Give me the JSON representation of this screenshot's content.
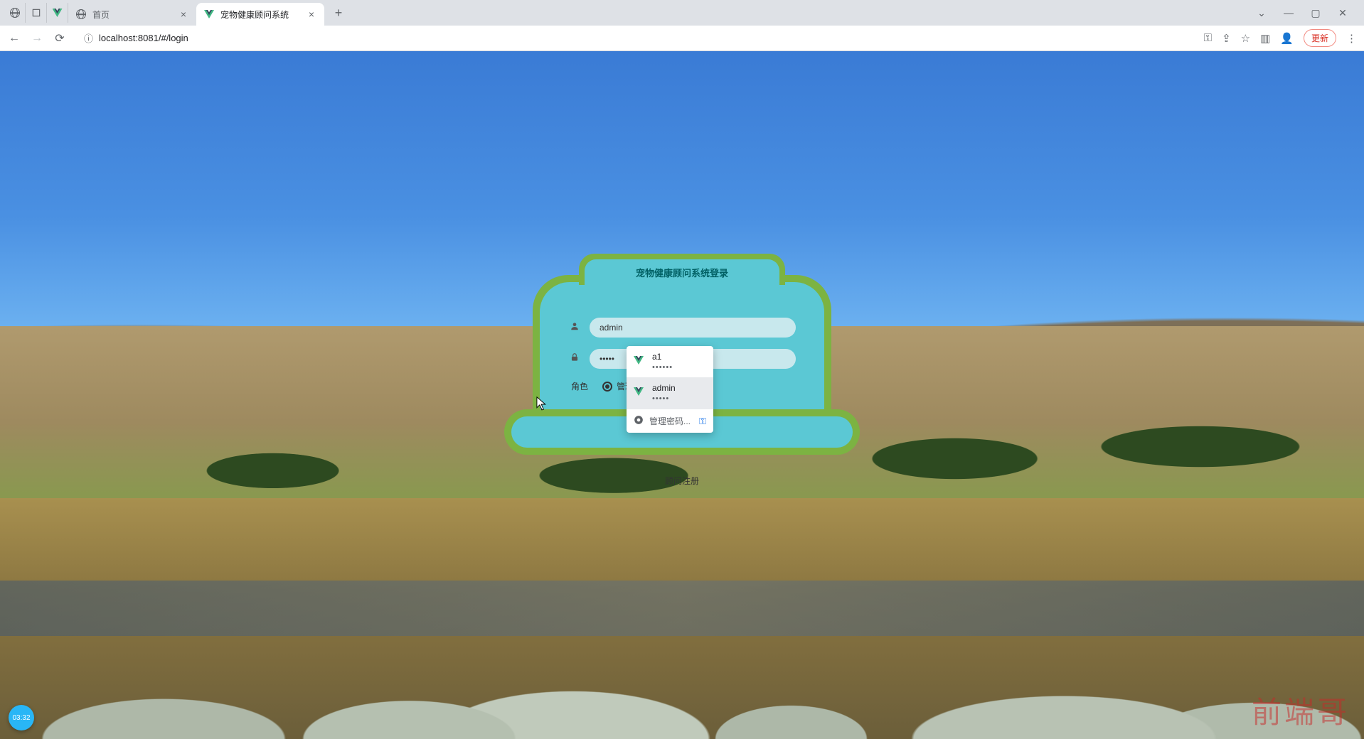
{
  "browser": {
    "tabs": [
      {
        "title": "首页",
        "active": false,
        "favicon": "globe"
      },
      {
        "title": "宠物健康顾问系统",
        "active": true,
        "favicon": "vue"
      }
    ],
    "url": "localhost:8081/#/login",
    "update_label": "更新",
    "menu_glyph": "⋮"
  },
  "login": {
    "title": "宠物健康顾问系统登录",
    "username_value": "admin",
    "password_masked": "•••••",
    "role_label": "角色",
    "role_option_admin": "管理员",
    "register_link": "顾问注册"
  },
  "autofill": {
    "items": [
      {
        "user": "a1",
        "pass": "••••••"
      },
      {
        "user": "admin",
        "pass": "•••••"
      }
    ],
    "manage_label": "管理密码..."
  },
  "watermark": "前端哥",
  "timestamp": "03:32"
}
